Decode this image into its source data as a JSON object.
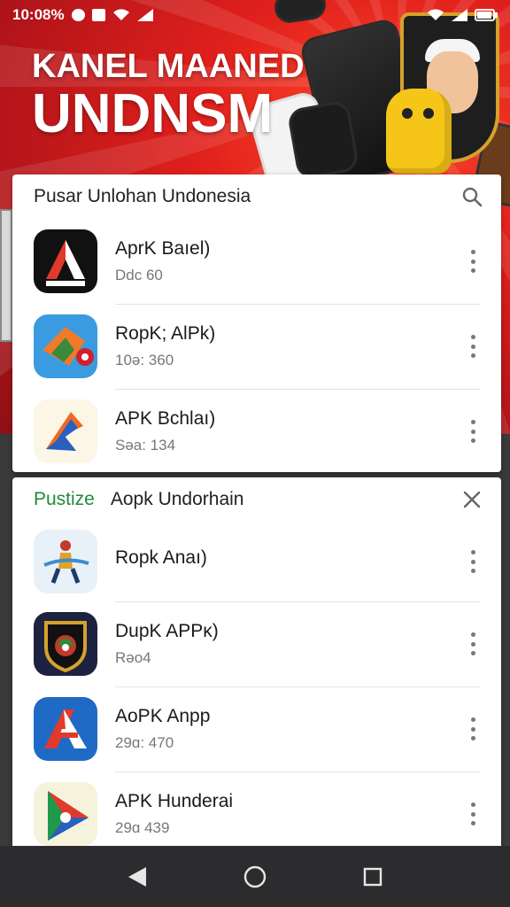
{
  "status_bar": {
    "time": "10:08%"
  },
  "hero": {
    "line1": "KANEL MAANED",
    "line2": "UNDNSM"
  },
  "card1": {
    "title": "Pusar Unlohan Undonesia",
    "apps": [
      {
        "name": "AprK Baıel)",
        "sub": "Ddc 60",
        "icon": "apk-a-black-icon"
      },
      {
        "name": "RopK; AlPk)",
        "sub": "10ə: 360",
        "icon": "apk-orange-blue-icon"
      },
      {
        "name": "APK Bchlaı)",
        "sub": "Səa: 134",
        "icon": "apk-colorful-a-icon"
      }
    ]
  },
  "card2": {
    "title_green": "Pustize",
    "title": "Aopk Undorhain",
    "apps": [
      {
        "name": "Ropk Anaı)",
        "sub": "",
        "icon": "runner-figure-icon"
      },
      {
        "name": "DupK APPĸ)",
        "sub": "Rəo4",
        "icon": "shield-emblem-icon"
      },
      {
        "name": "AoPK Anpp",
        "sub": "29ɑ: 470",
        "icon": "apk-red-blue-a-icon"
      },
      {
        "name": "APK Hunderai",
        "sub": "29ɑ 439",
        "icon": "apk-play-triangle-icon"
      }
    ]
  },
  "colors": {
    "accent_red": "#e0201c",
    "green": "#1f8a3a",
    "nav": "#2c2c2e"
  }
}
